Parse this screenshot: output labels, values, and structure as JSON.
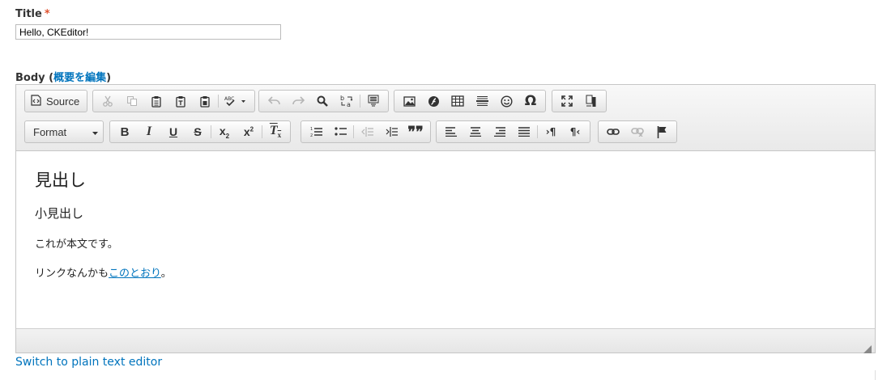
{
  "title_field": {
    "label": "Title",
    "required_mark": "*",
    "value": "Hello, CKEditor!"
  },
  "body_field": {
    "label": "Body",
    "open_paren": "(",
    "summary_link": "概要を編集",
    "close_paren": ")"
  },
  "toolbar": {
    "source_label": "Source",
    "format_label": "Format"
  },
  "content": {
    "heading1": "見出し",
    "heading2": "小見出し",
    "paragraph1": "これが本文です。",
    "paragraph2_text": "リンクなんかも",
    "paragraph2_link": "このとおり",
    "paragraph2_end": "。"
  },
  "switch_link": "Switch to plain text editor",
  "colors": {
    "link": "#0074bd",
    "required": "#e0522f"
  }
}
